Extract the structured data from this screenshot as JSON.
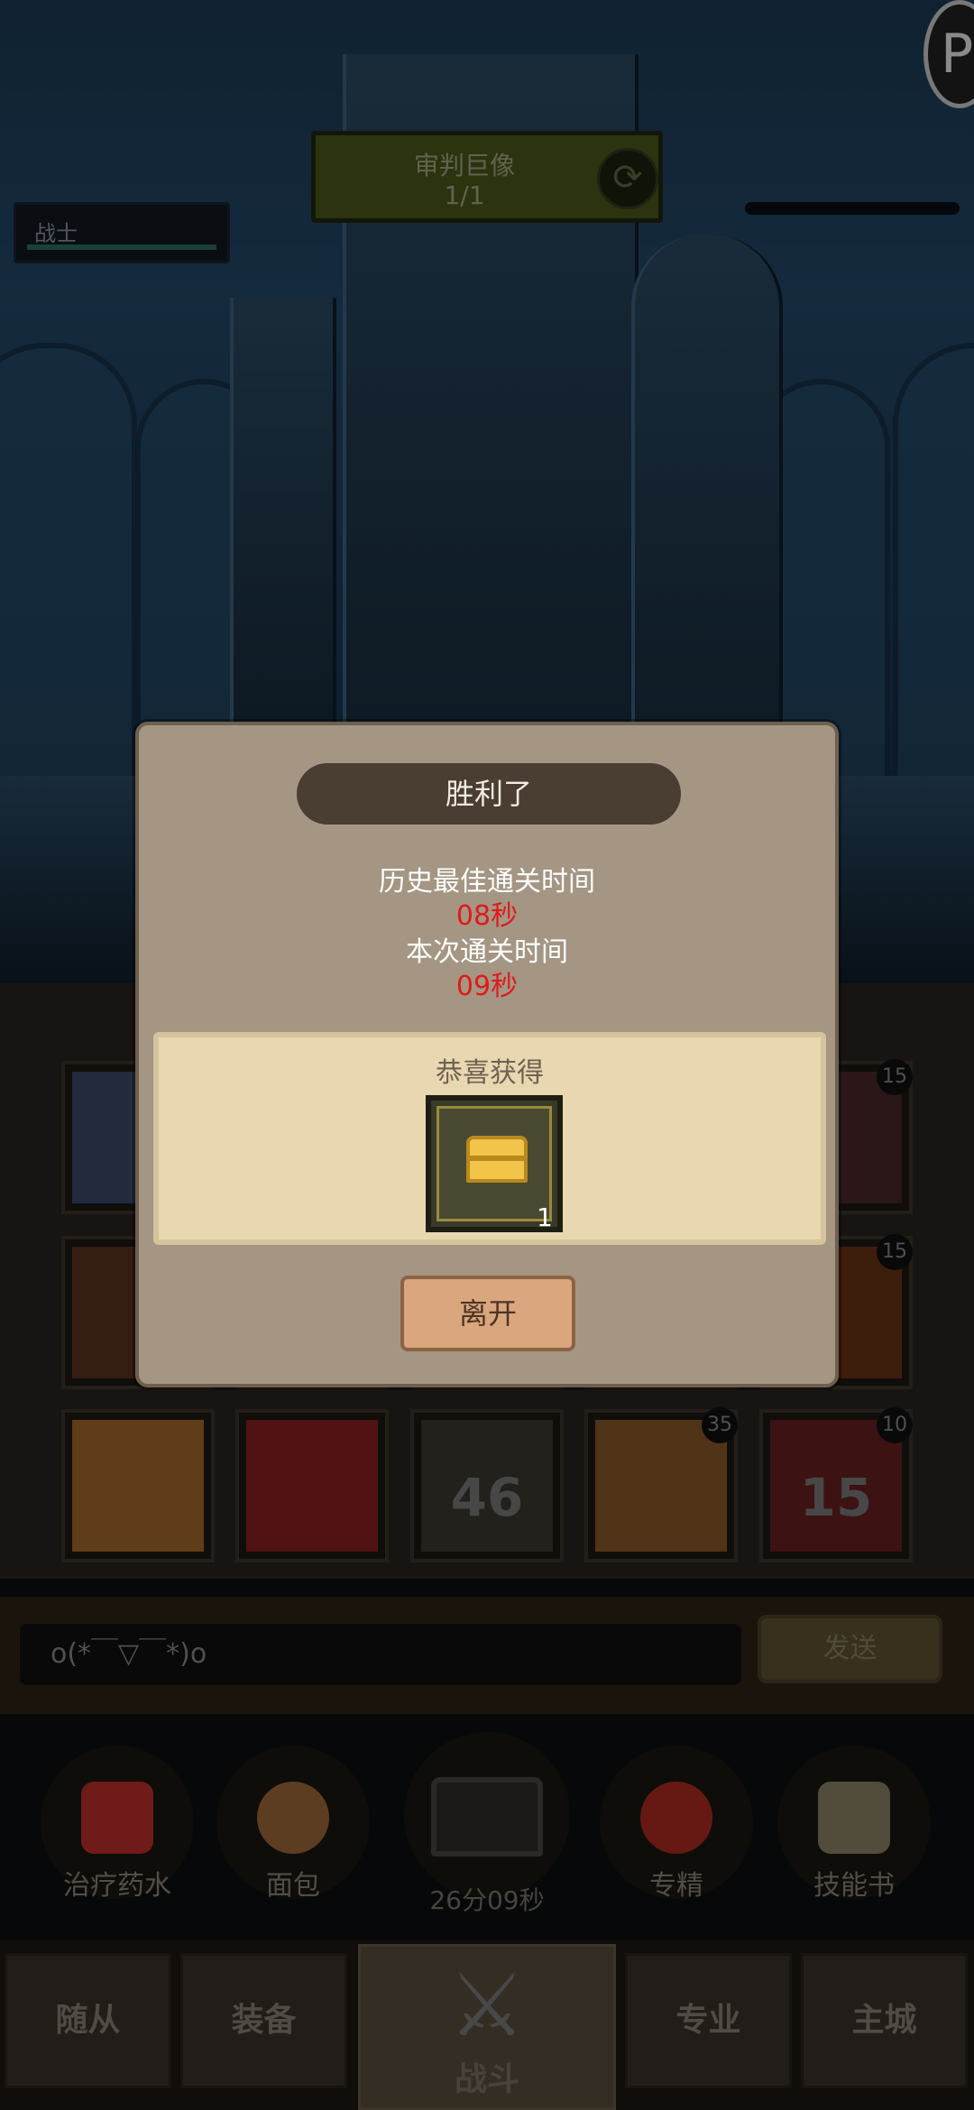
{
  "boss": {
    "name": "审判巨像",
    "count": "1/1",
    "refresh_icon": "refresh-icon"
  },
  "player": {
    "class_label": "战士"
  },
  "corner_button": {
    "glyph": "P"
  },
  "grid": {
    "slots": [
      {
        "badge": ""
      },
      {
        "badge": ""
      },
      {
        "badge": ""
      },
      {
        "badge": ""
      },
      {
        "badge": "15"
      },
      {
        "badge": ""
      },
      {
        "badge": ""
      },
      {
        "badge": ""
      },
      {
        "badge": ""
      },
      {
        "badge": "15"
      },
      {
        "badge": "",
        "label": ""
      },
      {
        "badge": "",
        "label": ""
      },
      {
        "badge": "",
        "label": "46"
      },
      {
        "badge": "35",
        "label": ""
      },
      {
        "badge": "10",
        "label": "15"
      }
    ]
  },
  "chat": {
    "text": "o(*￣▽￣*)o",
    "send_label": "发送"
  },
  "quick_items": [
    {
      "label": "治疗药水",
      "icon": "potion-icon",
      "color": "#c0302b"
    },
    {
      "label": "面包",
      "icon": "bread-icon",
      "color": "#a06a3c"
    },
    {
      "label": "专精",
      "icon": "specialization-icon",
      "color": "#b02c20"
    },
    {
      "label": "技能书",
      "icon": "skill-book-icon",
      "color": "#8e8468"
    }
  ],
  "chest_timer": "26分09秒",
  "tabs": {
    "followers": "随从",
    "equipment": "装备",
    "battle": "战斗",
    "profession": "专业",
    "main_city": "主城"
  },
  "dialog": {
    "title": "胜利了",
    "best_label": "历史最佳通关时间",
    "best_time": "08秒",
    "current_label": "本次通关时间",
    "current_time": "09秒",
    "reward_title": "恭喜获得",
    "reward_count": "1",
    "leave_label": "离开",
    "reward_icon": "treasure-chest-icon"
  },
  "colors": {
    "accent_red": "#e01a1a",
    "boss_panel": "#4b5a1b"
  }
}
